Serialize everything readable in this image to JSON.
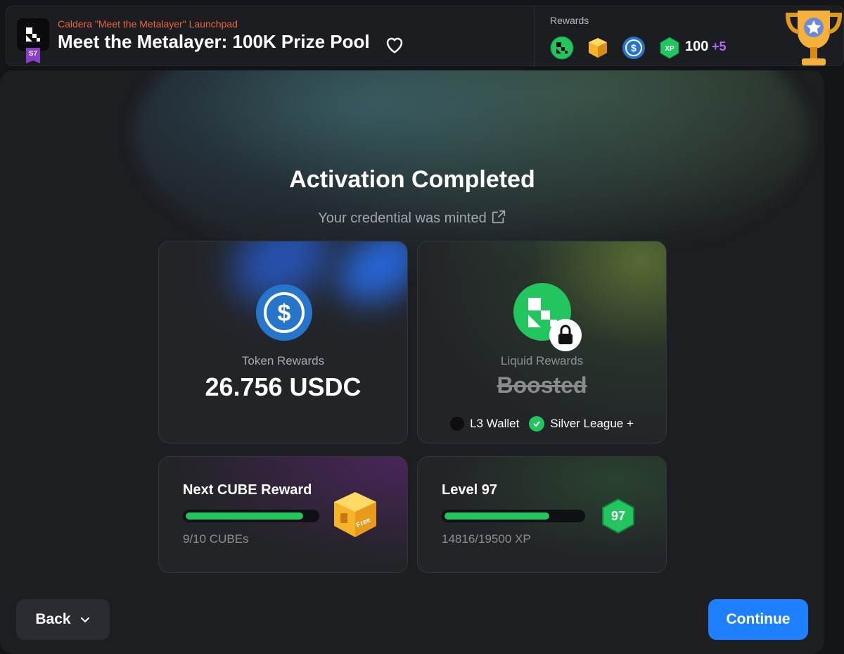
{
  "header": {
    "season_badge": "S7",
    "campaign_subtitle": "Caldera \"Meet the Metalayer\" Launchpad",
    "title": "Meet the Metalayer: 100K Prize Pool",
    "rewards_label": "Rewards",
    "reward_icons": [
      "caldera-token-icon",
      "cube-icon",
      "usdc-icon",
      "xp-icon"
    ],
    "xp_icon_text": "XP",
    "xp_amount": "100",
    "xp_bonus": "+5"
  },
  "main": {
    "title": "Activation Completed",
    "minted_text": "Your credential was minted"
  },
  "token_card": {
    "label": "Token Rewards",
    "value": "26.756 USDC"
  },
  "liquid_card": {
    "label": "Liquid Rewards",
    "value": "Boosted",
    "requirements": [
      {
        "label": "L3 Wallet",
        "met": false
      },
      {
        "label": "Silver League +",
        "met": true
      }
    ]
  },
  "cube_card": {
    "title": "Next CUBE Reward",
    "progress": 0.9,
    "progress_text": "9/10 CUBEs",
    "cube_tag": "Free"
  },
  "level_card": {
    "title": "Level 97",
    "progress": 0.76,
    "progress_text": "14816/19500 XP",
    "badge": "97"
  },
  "footer": {
    "back_label": "Back",
    "continue_label": "Continue"
  },
  "colors": {
    "accent_blue": "#1f80ff",
    "success_green": "#22c55e",
    "subtitle_orange": "#e7683c",
    "xp_purple": "#b06ef0"
  }
}
